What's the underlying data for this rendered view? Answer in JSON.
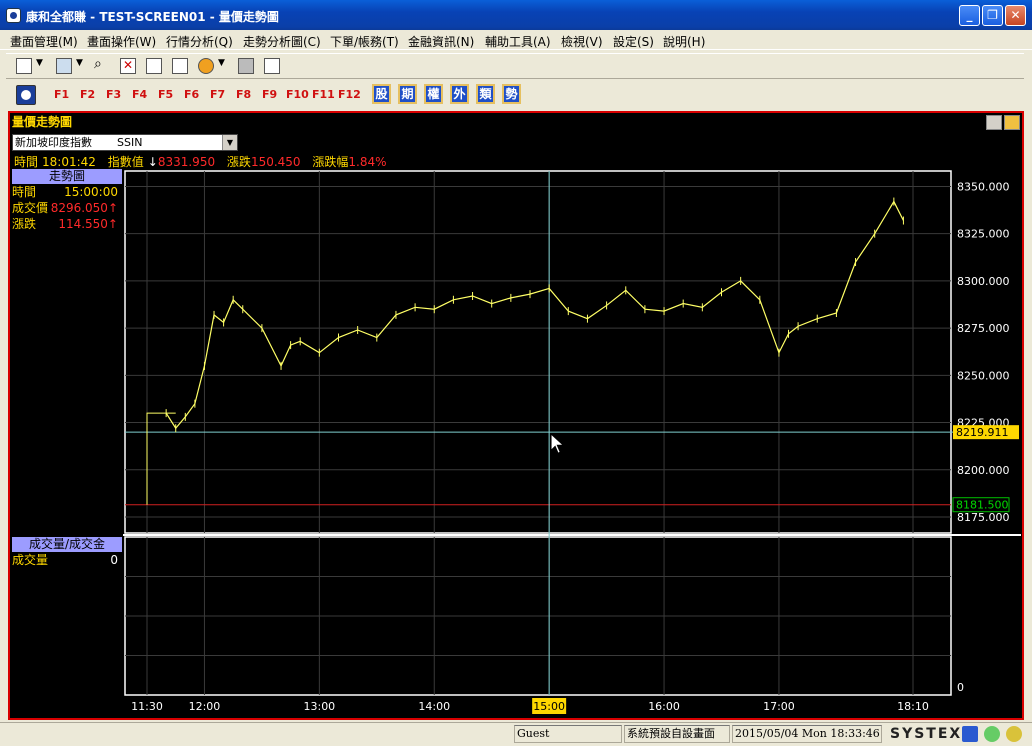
{
  "window": {
    "title": "康和全都賺 - TEST-SCREEN01 - 量價走勢圖"
  },
  "menu": [
    "畫面管理(M)",
    "畫面操作(W)",
    "行情分析(Q)",
    "走勢分析圖(C)",
    "下單/帳務(T)",
    "金融資訊(N)",
    "輔助工具(A)",
    "檢視(V)",
    "設定(S)",
    "說明(H)"
  ],
  "fkeys": [
    "F1",
    "F2",
    "F3",
    "F4",
    "F5",
    "F6",
    "F7",
    "F8",
    "F9",
    "F10",
    "F11",
    "F12"
  ],
  "category_buttons": [
    "股",
    "期",
    "權",
    "外",
    "類",
    "勢"
  ],
  "panel": {
    "title": "量價走勢圖",
    "selector": {
      "name": "新加坡印度指數",
      "code": "SSIN"
    },
    "info": {
      "time_label": "時間",
      "time": "18:01:42",
      "index_label": "指數值",
      "index_arrow": "↓",
      "index": "8331.950",
      "change_label": "漲跌",
      "change": "150.450",
      "pct_label": "漲跌幅",
      "pct": "1.84%"
    },
    "price_box": {
      "header": "走勢圖",
      "rows": [
        {
          "label": "時間",
          "value": "15:00:00",
          "color": "#ffd800"
        },
        {
          "label": "成交價",
          "value": "8296.050↑",
          "color": "#ff2a2a",
          "value_color_white": "8296.050"
        },
        {
          "label": "漲跌",
          "value": "114.550↑",
          "color": "#ff2a2a"
        }
      ]
    },
    "volume_box": {
      "header": "成交量/成交金",
      "rows": [
        {
          "label": "成交量",
          "value": "0"
        }
      ]
    }
  },
  "chart_data": {
    "type": "line",
    "title": "",
    "x_ticks": [
      "11:30",
      "12:00",
      "13:00",
      "14:00",
      "15:00",
      "16:00",
      "17:00",
      "18:10"
    ],
    "y_ticks": [
      "8350.000",
      "8325.000",
      "8300.000",
      "8275.000",
      "8250.000",
      "8225.000",
      "8200.000",
      "8175.000"
    ],
    "ylim": [
      8175,
      8355
    ],
    "cursor_time": "15:00",
    "cursor_price": "8219.911",
    "reference_price": "8181.500",
    "volume_axis_label": "0",
    "series": [
      {
        "color": "#ffff66",
        "x": [
          "11:30",
          "11:40",
          "11:45",
          "11:50",
          "11:55",
          "12:00",
          "12:05",
          "12:10",
          "12:15",
          "12:20",
          "12:30",
          "12:40",
          "12:45",
          "12:50",
          "13:00",
          "13:10",
          "13:20",
          "13:30",
          "13:40",
          "13:50",
          "14:00",
          "14:10",
          "14:20",
          "14:30",
          "14:40",
          "14:50",
          "15:00",
          "15:10",
          "15:20",
          "15:30",
          "15:40",
          "15:50",
          "16:00",
          "16:10",
          "16:20",
          "16:30",
          "16:40",
          "16:50",
          "17:00",
          "17:05",
          "17:10",
          "17:20",
          "17:30",
          "17:40",
          "17:50",
          "18:00",
          "18:05"
        ],
        "values": [
          8181.5,
          8230,
          8222,
          8228,
          8235,
          8255,
          8282,
          8278,
          8290,
          8285,
          8275,
          8255,
          8266,
          8268,
          8262,
          8270,
          8274,
          8270,
          8282,
          8286,
          8285,
          8290,
          8292,
          8288,
          8291,
          8293,
          8296,
          8284,
          8280,
          8287,
          8295,
          8285,
          8284,
          8288,
          8286,
          8294,
          8300,
          8290,
          8262,
          8272,
          8276,
          8280,
          8283,
          8310,
          8325,
          8342,
          8331.95
        ]
      }
    ]
  },
  "status": {
    "user": "Guest",
    "layout": "系統預設自設畫面",
    "datetime": "2015/05/04 Mon 18:33:46",
    "brand": "SYSTEX"
  }
}
